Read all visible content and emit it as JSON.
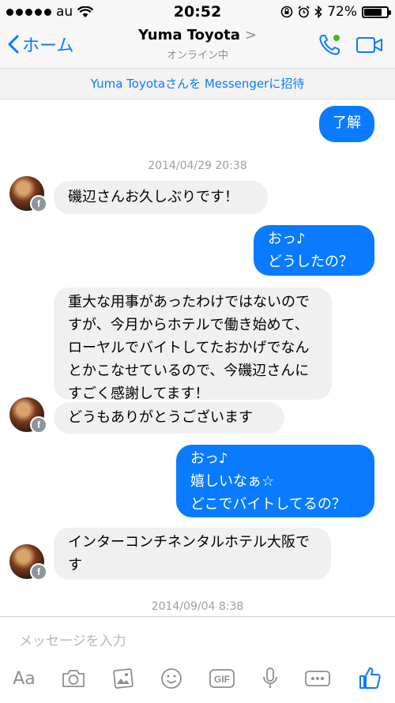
{
  "status_bar": {
    "carrier": "au",
    "time": "20:52",
    "battery": "72%"
  },
  "nav": {
    "back_label": "ホーム",
    "name": "Yuma Toyota",
    "chevron": ">",
    "status": "オンライン中"
  },
  "invite_text": "Yuma Toyotaさんを Messengerに招待",
  "messages": [
    {
      "dir": "out",
      "text": "了解"
    },
    {
      "dir": "ts",
      "text": "2014/04/29 20:38"
    },
    {
      "dir": "in",
      "text": "磯辺さんお久しぶりです！"
    },
    {
      "dir": "out",
      "text": "おっ♪\nどうしたの？"
    },
    {
      "dir": "in",
      "text": "重大な用事があったわけではないのですが、今月からホテルで働き始めて、ローヤルでバイトしてたおかげでなんとかこなせているので、今磯辺さんにすごく感謝してます！"
    },
    {
      "dir": "in",
      "text": "どうもありがとうございます"
    },
    {
      "dir": "out",
      "text": "おっ♪\n嬉しいなぁ☆\nどこでバイトしてるの？"
    },
    {
      "dir": "in",
      "text": "インターコンチネンタルホテル大阪です"
    },
    {
      "dir": "ts",
      "text": "2014/09/04 8:38"
    }
  ],
  "composer": {
    "placeholder": "メッセージを入力",
    "aa_label": "Aa",
    "tools": [
      "camera-icon",
      "photo-icon",
      "smiley-icon",
      "gif-icon",
      "mic-icon",
      "more-icon",
      "like-icon"
    ],
    "gif_label": "GIF"
  },
  "colors": {
    "accent": "#0a7bff",
    "incoming_bubble": "#f1f0f0",
    "online": "#42b72a"
  }
}
